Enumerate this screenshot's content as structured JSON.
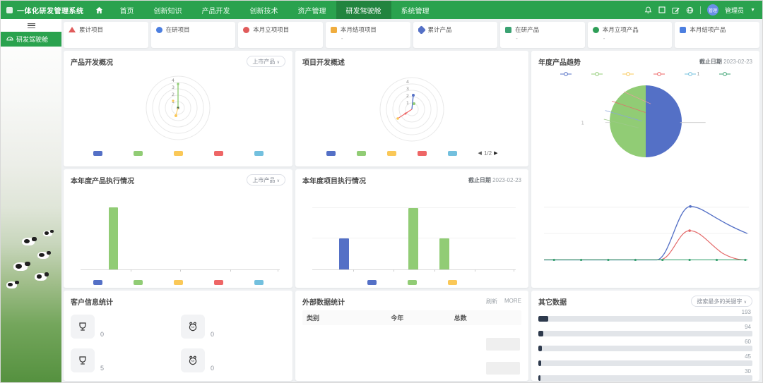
{
  "header": {
    "app_title": "一体化研发管理系统",
    "nav": [
      {
        "label": "首页"
      },
      {
        "label": "创新知识"
      },
      {
        "label": "产品开发"
      },
      {
        "label": "创新技术"
      },
      {
        "label": "资产管理"
      },
      {
        "label": "研发驾驶舱",
        "active": true
      },
      {
        "label": "系统管理"
      }
    ],
    "user": {
      "avatar_text": "管理",
      "name": "管理员"
    }
  },
  "sidebar": {
    "items": [
      {
        "label": "研发驾驶舱",
        "active": true
      }
    ]
  },
  "palette": {
    "blue": "#5470c6",
    "green": "#91cc75",
    "yellow": "#fac858",
    "red": "#ee6666",
    "cyan": "#73c0de",
    "teal": "#3ba272"
  },
  "stat_cards": [
    {
      "label": "累计项目",
      "value": "",
      "icon_color": "#e05b5b"
    },
    {
      "label": "在研项目",
      "value": "",
      "icon_color": "#4c7fe0"
    },
    {
      "label": "本月立项项目",
      "value": "",
      "icon_color": "#e05b5b"
    },
    {
      "label": "本月结项项目",
      "value": "-",
      "icon_color": "#f0ad3e"
    },
    {
      "label": "累计产品",
      "value": "",
      "icon_color": "#5470c6"
    },
    {
      "label": "在研产品",
      "value": "-",
      "icon_color": "#3ba272"
    },
    {
      "label": "本月立项产品",
      "value": "-",
      "icon_color": "#2e9e57"
    },
    {
      "label": "本月结项产品",
      "value": "",
      "icon_color": "#4c7fe0"
    }
  ],
  "panels": {
    "product_overview": {
      "title": "产品开发概况",
      "filter": "上市产品"
    },
    "project_overview": {
      "title": "项目开发概述",
      "pagination": "1/2"
    },
    "annual_trend": {
      "title": "年度产品趋势",
      "deadline_label": "截止日期",
      "deadline": "2023-02-23",
      "legend_label_5": "1",
      "pie_left_label": "1"
    },
    "product_exec": {
      "title": "本年度产品执行情况",
      "filter": "上市产品"
    },
    "project_exec": {
      "title": "本年度项目执行情况",
      "deadline_label": "截止日期",
      "deadline": "2023-02-23"
    },
    "customer_stats": {
      "title": "客户信息统计",
      "items": [
        {
          "value": "0"
        },
        {
          "value": "0"
        },
        {
          "value": "5"
        },
        {
          "value": "0"
        }
      ]
    },
    "external_data": {
      "title": "外部数据统计",
      "actions": [
        "刷新",
        "MORE"
      ],
      "columns": [
        "类别",
        "今年",
        "总数"
      ]
    },
    "other_data": {
      "title": "其它数据",
      "filter": "搜索最多的关键字"
    }
  },
  "chart_data": [
    {
      "id": "product_radar",
      "type": "scatter",
      "subtype": "radar",
      "tick_labels": [
        "1",
        "2",
        "3",
        "4"
      ],
      "max": 4,
      "series": [
        {
          "name": "green-spoke",
          "color": "#91cc75",
          "value": 3
        },
        {
          "name": "yellow-point",
          "color": "#fac858",
          "value": 0.5
        }
      ],
      "legend_colors": [
        "#5470c6",
        "#91cc75",
        "#fac858",
        "#ee6666",
        "#73c0de"
      ]
    },
    {
      "id": "project_radar",
      "type": "scatter",
      "subtype": "radar",
      "tick_labels": [
        "1",
        "2",
        "3",
        "4"
      ],
      "max": 4,
      "series": [
        {
          "name": "blue-spoke",
          "color": "#5470c6",
          "value": 2
        },
        {
          "name": "red-spoke",
          "color": "#ee6666",
          "value": 1.5
        },
        {
          "name": "green-point",
          "color": "#91cc75",
          "value": 0.5
        }
      ],
      "legend_colors": [
        "#5470c6",
        "#91cc75",
        "#fac858",
        "#ee6666",
        "#73c0de"
      ]
    },
    {
      "id": "annual_product_pie",
      "type": "pie",
      "slices": [
        {
          "color": "#91cc75",
          "percent": 50
        },
        {
          "color": "#5470c6",
          "percent": 50
        }
      ],
      "legend_colors": [
        "#5470c6",
        "#91cc75",
        "#fac858",
        "#ee6666",
        "#73c0de",
        "#3ba272"
      ]
    },
    {
      "id": "annual_product_line",
      "type": "line",
      "ylim": [
        0,
        2
      ],
      "grid": true,
      "series": [
        {
          "name": "blue",
          "color": "#5470c6",
          "peak": 2,
          "end": 1
        },
        {
          "name": "red",
          "color": "#ee6666",
          "peak": 1,
          "end": 0
        },
        {
          "name": "teal-flat",
          "color": "#3ba272",
          "flat": 0
        }
      ]
    },
    {
      "id": "product_exec_bar",
      "type": "bar",
      "ylim": [
        0,
        2
      ],
      "bars": [
        {
          "color": "#91cc75",
          "value": 2
        }
      ],
      "legend_colors": [
        "#5470c6",
        "#91cc75",
        "#fac858",
        "#ee6666",
        "#73c0de"
      ]
    },
    {
      "id": "project_exec_bar",
      "type": "bar",
      "ylim": [
        0,
        2
      ],
      "bars": [
        {
          "color": "#5470c6",
          "value": 1
        },
        {
          "color": "#91cc75",
          "value": 2
        },
        {
          "color": "#91cc75",
          "value": 1
        }
      ],
      "legend_colors": [
        "#5470c6",
        "#91cc75",
        "#fac858"
      ]
    },
    {
      "id": "other_data_bars",
      "type": "bar",
      "subtype": "horizontal",
      "values": [
        "193",
        "94",
        "60",
        "45",
        "30"
      ]
    }
  ]
}
